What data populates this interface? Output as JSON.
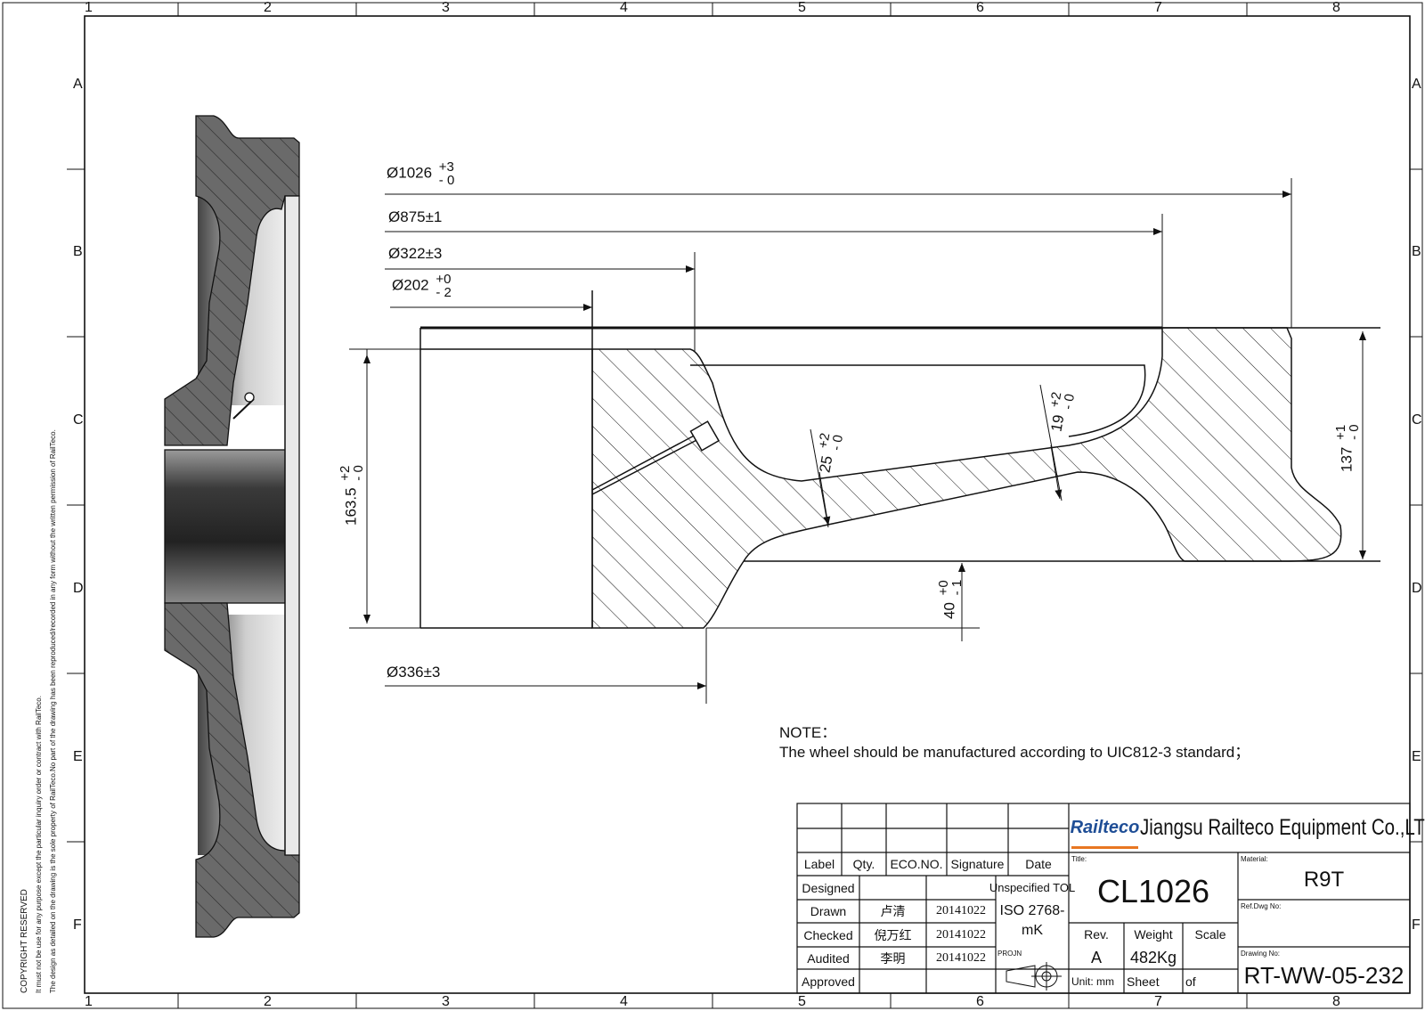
{
  "zones": {
    "columns": [
      "1",
      "2",
      "3",
      "4",
      "5",
      "6",
      "7",
      "8"
    ],
    "rows": [
      "A",
      "B",
      "C",
      "D",
      "E",
      "F"
    ]
  },
  "dimensions": {
    "d1026": {
      "sym": "Ø",
      "value": "1026",
      "upper": "+3",
      "lower": "- 0"
    },
    "d875": {
      "sym": "Ø",
      "value": "875±1"
    },
    "d322": {
      "sym": "Ø",
      "value": "322±3"
    },
    "d202": {
      "sym": "Ø",
      "value": "202",
      "upper": "+0",
      "lower": "- 2"
    },
    "d336": {
      "sym": "Ø",
      "value": "336±3"
    },
    "h163": {
      "value": "163.5",
      "upper": "+2",
      "lower": "- 0"
    },
    "w25": {
      "value": "25",
      "upper": "+2",
      "lower": "- 0"
    },
    "w19": {
      "value": "19",
      "upper": "+2",
      "lower": "- 0"
    },
    "h137": {
      "value": "137",
      "upper": "+1",
      "lower": "- 0"
    },
    "h40": {
      "value": "40",
      "upper": "+0",
      "lower": "- 1"
    }
  },
  "note": {
    "title": "NOTE：",
    "text": "The wheel should be manufactured according to UIC812-3 standard；"
  },
  "copyright": {
    "title": "COPYRIGHT RESERVED",
    "line1": "It must not be use for any purpose except the particular inquiry order or contract with RailTeco.",
    "line2": "The design as detailed on the drawing is the sole property of RailTeco.No part of the drawing has been reproduced/recorded in any form without the written permission of RailTeco."
  },
  "title_block": {
    "logo": "Railteco",
    "company": "Jiangsu Railteco Equipment Co.,LTD",
    "headers": {
      "label": "Label",
      "qty": "Qty.",
      "eco": "ECO.NO.",
      "signature": "Signature",
      "date": "Date"
    },
    "rows": [
      {
        "label": "Designed",
        "name": "",
        "date": ""
      },
      {
        "label": "Drawn",
        "name": "卢清",
        "date": "20141022"
      },
      {
        "label": "Checked",
        "name": "倪万红",
        "date": "20141022"
      },
      {
        "label": "Audited",
        "name": "李明",
        "date": "20141022"
      },
      {
        "label": "Approved",
        "name": "",
        "date": ""
      }
    ],
    "unspecified_tol": "Unspecified TOL",
    "iso": "ISO 2768-",
    "iso2": "mK",
    "proj_label": "PROJN",
    "title_label": "Title:",
    "title_value": "CL1026",
    "material_label": "Material:",
    "material_value": "R9T",
    "ref_label": "Ref.Dwg No:",
    "rev_label": "Rev.",
    "rev_value": "A",
    "weight_label": "Weight",
    "weight_value": "482Kg",
    "scale_label": "Scale",
    "unit_label": "Unit: mm",
    "sheet_label": "Sheet",
    "of_label": "of",
    "drawing_no_label": "Drawing No:",
    "drawing_no_value": "RT-WW-05-232"
  },
  "colors": {
    "line": "#111111",
    "section_fill": "#5a5a5a",
    "logo_orange": "#e87722",
    "logo_blue": "#1f4e96"
  }
}
